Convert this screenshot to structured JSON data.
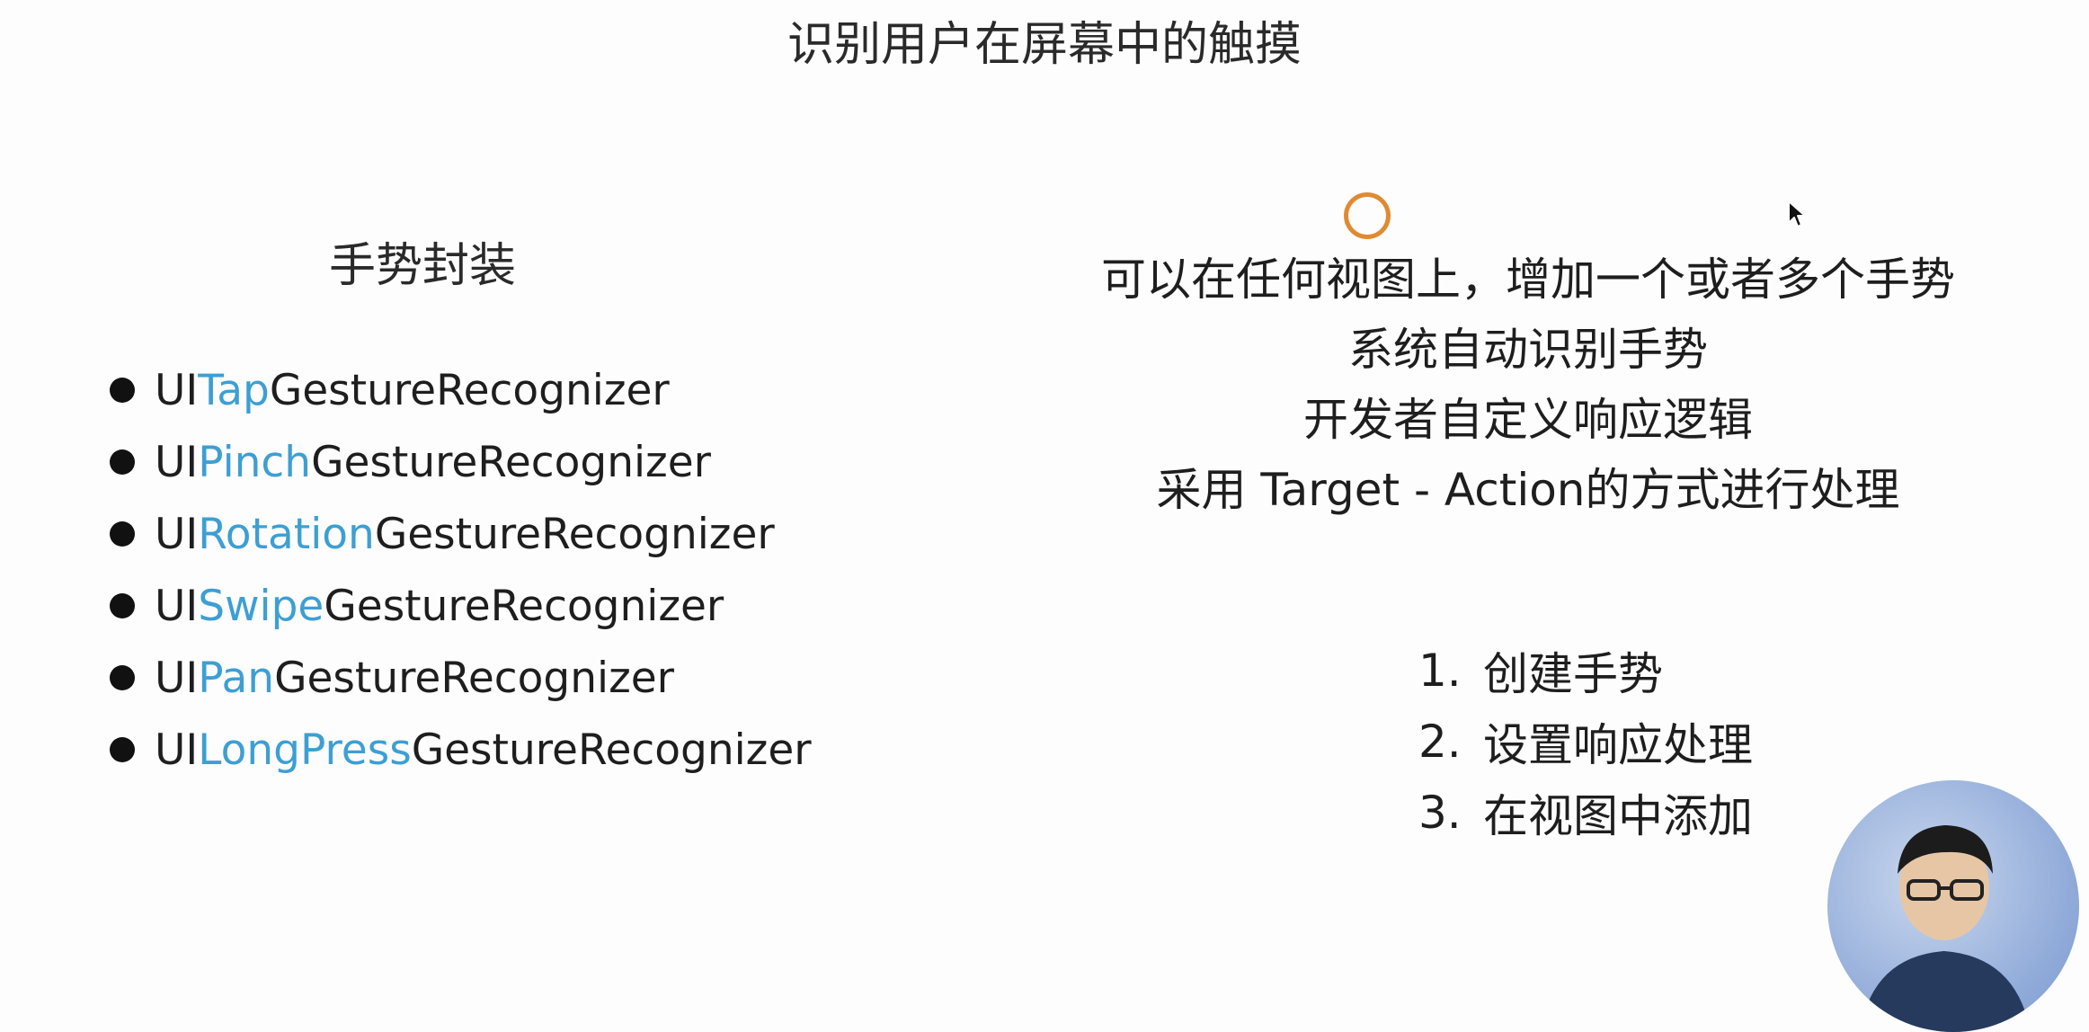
{
  "slide": {
    "title": "识别用户在屏幕中的触摸",
    "left_heading": "手势封装",
    "recognizers": [
      {
        "prefix": "UI",
        "accent": "Tap",
        "suffix": "GestureRecognizer"
      },
      {
        "prefix": "UI",
        "accent": "Pinch",
        "suffix": "GestureRecognizer"
      },
      {
        "prefix": "UI",
        "accent": "Rotation",
        "suffix": "GestureRecognizer"
      },
      {
        "prefix": "UI",
        "accent": "Swipe",
        "suffix": "GestureRecognizer"
      },
      {
        "prefix": "UI",
        "accent": "Pan",
        "suffix": "GestureRecognizer"
      },
      {
        "prefix": "UI",
        "accent": "LongPress",
        "suffix": "GestureRecognizer"
      }
    ],
    "description_lines": [
      "可以在任何视图上，增加一个或者多个手势",
      "系统自动识别手势",
      "开发者自定义响应逻辑",
      "采用 Target - Action的方式进行处理"
    ],
    "steps": [
      {
        "num": "1.",
        "text": "创建手势"
      },
      {
        "num": "2.",
        "text": "设置响应处理"
      },
      {
        "num": "3.",
        "text": "在视图中添加"
      }
    ]
  },
  "colors": {
    "background": "#fdfdfd",
    "text": "#1e1e1e",
    "accent": "#3d9fd3",
    "click_ring": "#e08a33"
  },
  "icons": {
    "cursor": "arrow-pointer-icon",
    "click_indicator": "click-ring-icon",
    "presenter": "presenter-video-thumbnail"
  }
}
